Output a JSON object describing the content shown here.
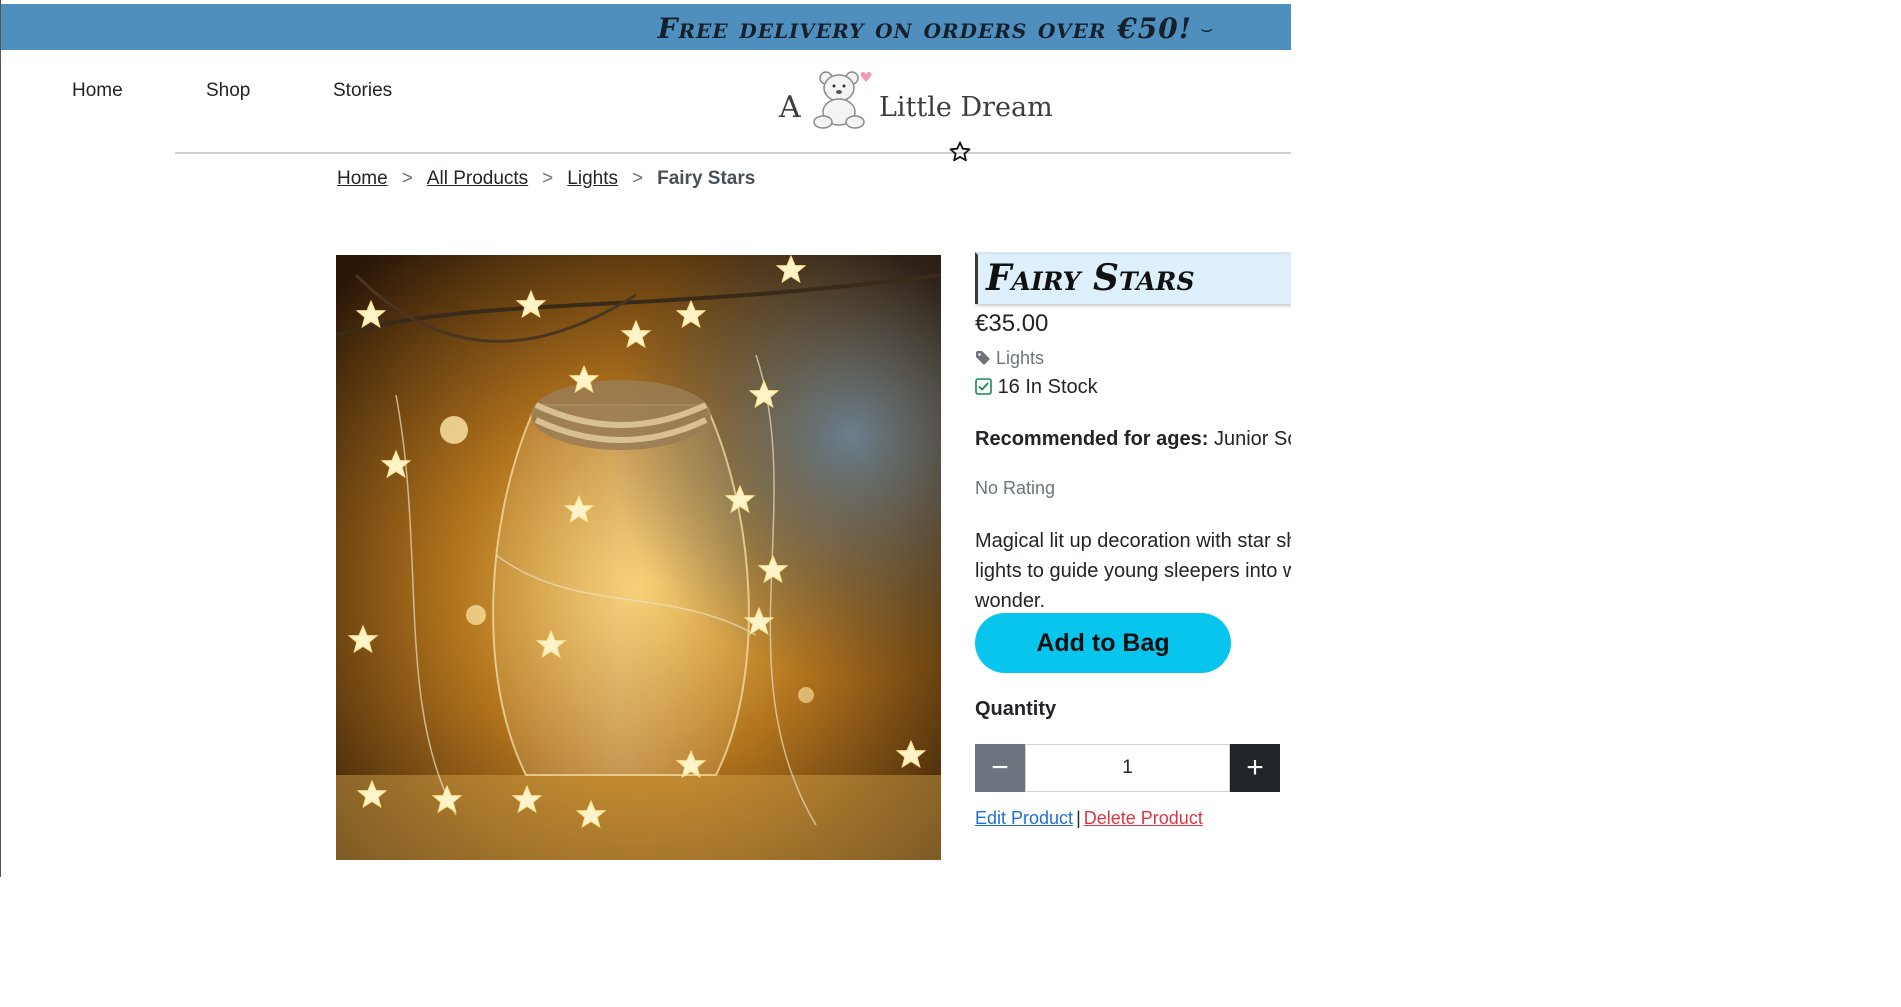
{
  "banner": {
    "text": "Free delivery on orders over €50!",
    "chevron": "⌣"
  },
  "nav": {
    "items": [
      "Home",
      "Shop",
      "Stories"
    ]
  },
  "logo": {
    "prefix": "A",
    "name": "Little Dream"
  },
  "breadcrumb": {
    "items": [
      "Home",
      "All Products",
      "Lights"
    ],
    "separator": ">",
    "current": "Fairy Stars"
  },
  "product": {
    "title": "Fairy Stars",
    "price": "€35.00",
    "category": "Lights",
    "stock": "16 In Stock",
    "ages_label": "Recommended for ages:",
    "ages_value": "Junior School",
    "rating": "No Rating",
    "description": "Magical lit up decoration with star shaped lights to guide young sleepers into world of wonder."
  },
  "actions": {
    "add_to_bag": "Add to Bag",
    "quantity_label": "Quantity",
    "quantity_value": "1",
    "minus": "−",
    "plus": "+"
  },
  "admin": {
    "edit": "Edit Product",
    "pipe": "|",
    "delete": "Delete Product"
  },
  "colors": {
    "banner": "#4f8fbe",
    "title_bg": "#ddf0fc",
    "add_button": "#08c5ed",
    "minus_button": "#6c757d",
    "plus_button": "#212529",
    "edit_link": "#1f6fd1",
    "delete_link": "#dc3545"
  },
  "icons": {
    "wishlist": "star-outline-icon",
    "tag": "tag-icon",
    "stock": "checkbox-icon",
    "logo": "teddy-bear-icon"
  }
}
